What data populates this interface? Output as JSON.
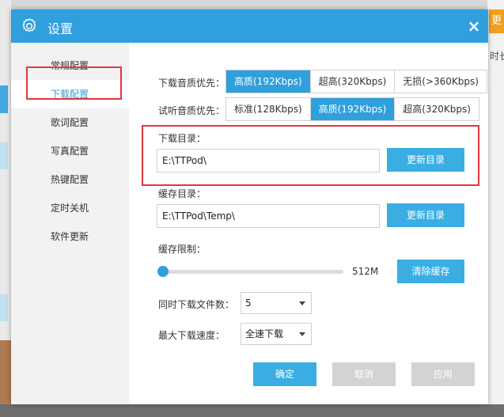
{
  "background": {
    "right_button_label": "更",
    "right_text": "时长"
  },
  "dialog": {
    "title": "设置",
    "close_glyph": "×"
  },
  "sidebar": {
    "items": [
      {
        "label": "常规配置"
      },
      {
        "label": "下载配置",
        "active": true
      },
      {
        "label": "歌词配置"
      },
      {
        "label": "写真配置"
      },
      {
        "label": "热键配置"
      },
      {
        "label": "定时关机"
      },
      {
        "label": "软件更新"
      }
    ]
  },
  "download": {
    "quality_label": "下载音质优先：",
    "quality_options": [
      "高质(192Kbps)",
      "超高(320Kbps)",
      "无损(>360Kbps)"
    ],
    "quality_selected": "高质(192Kbps)",
    "listen_label": "试听音质优先：",
    "listen_options": [
      "标准(128Kbps)",
      "高质(192Kbps)",
      "超高(320Kbps)"
    ],
    "listen_selected": "高质(192Kbps)",
    "dir_label": "下载目录：",
    "dir_value": "E:\\TTPod\\",
    "dir_button": "更新目录",
    "cache_dir_label": "缓存目录：",
    "cache_dir_value": "E:\\TTPod\\Temp\\",
    "cache_dir_button": "更新目录",
    "cache_limit_label": "缓存限制：",
    "cache_limit_value": "512M",
    "cache_limit_fraction": 0.0,
    "clear_cache_button": "清除缓存",
    "concurrent_label": "同时下载文件数：",
    "concurrent_value": "5",
    "speed_label": "最大下载速度：",
    "speed_value": "全速下载"
  },
  "footer": {
    "ok": "确定",
    "cancel": "取消",
    "apply": "应用"
  },
  "colors": {
    "accent": "#2f9fde",
    "highlight": "#e0373d"
  }
}
